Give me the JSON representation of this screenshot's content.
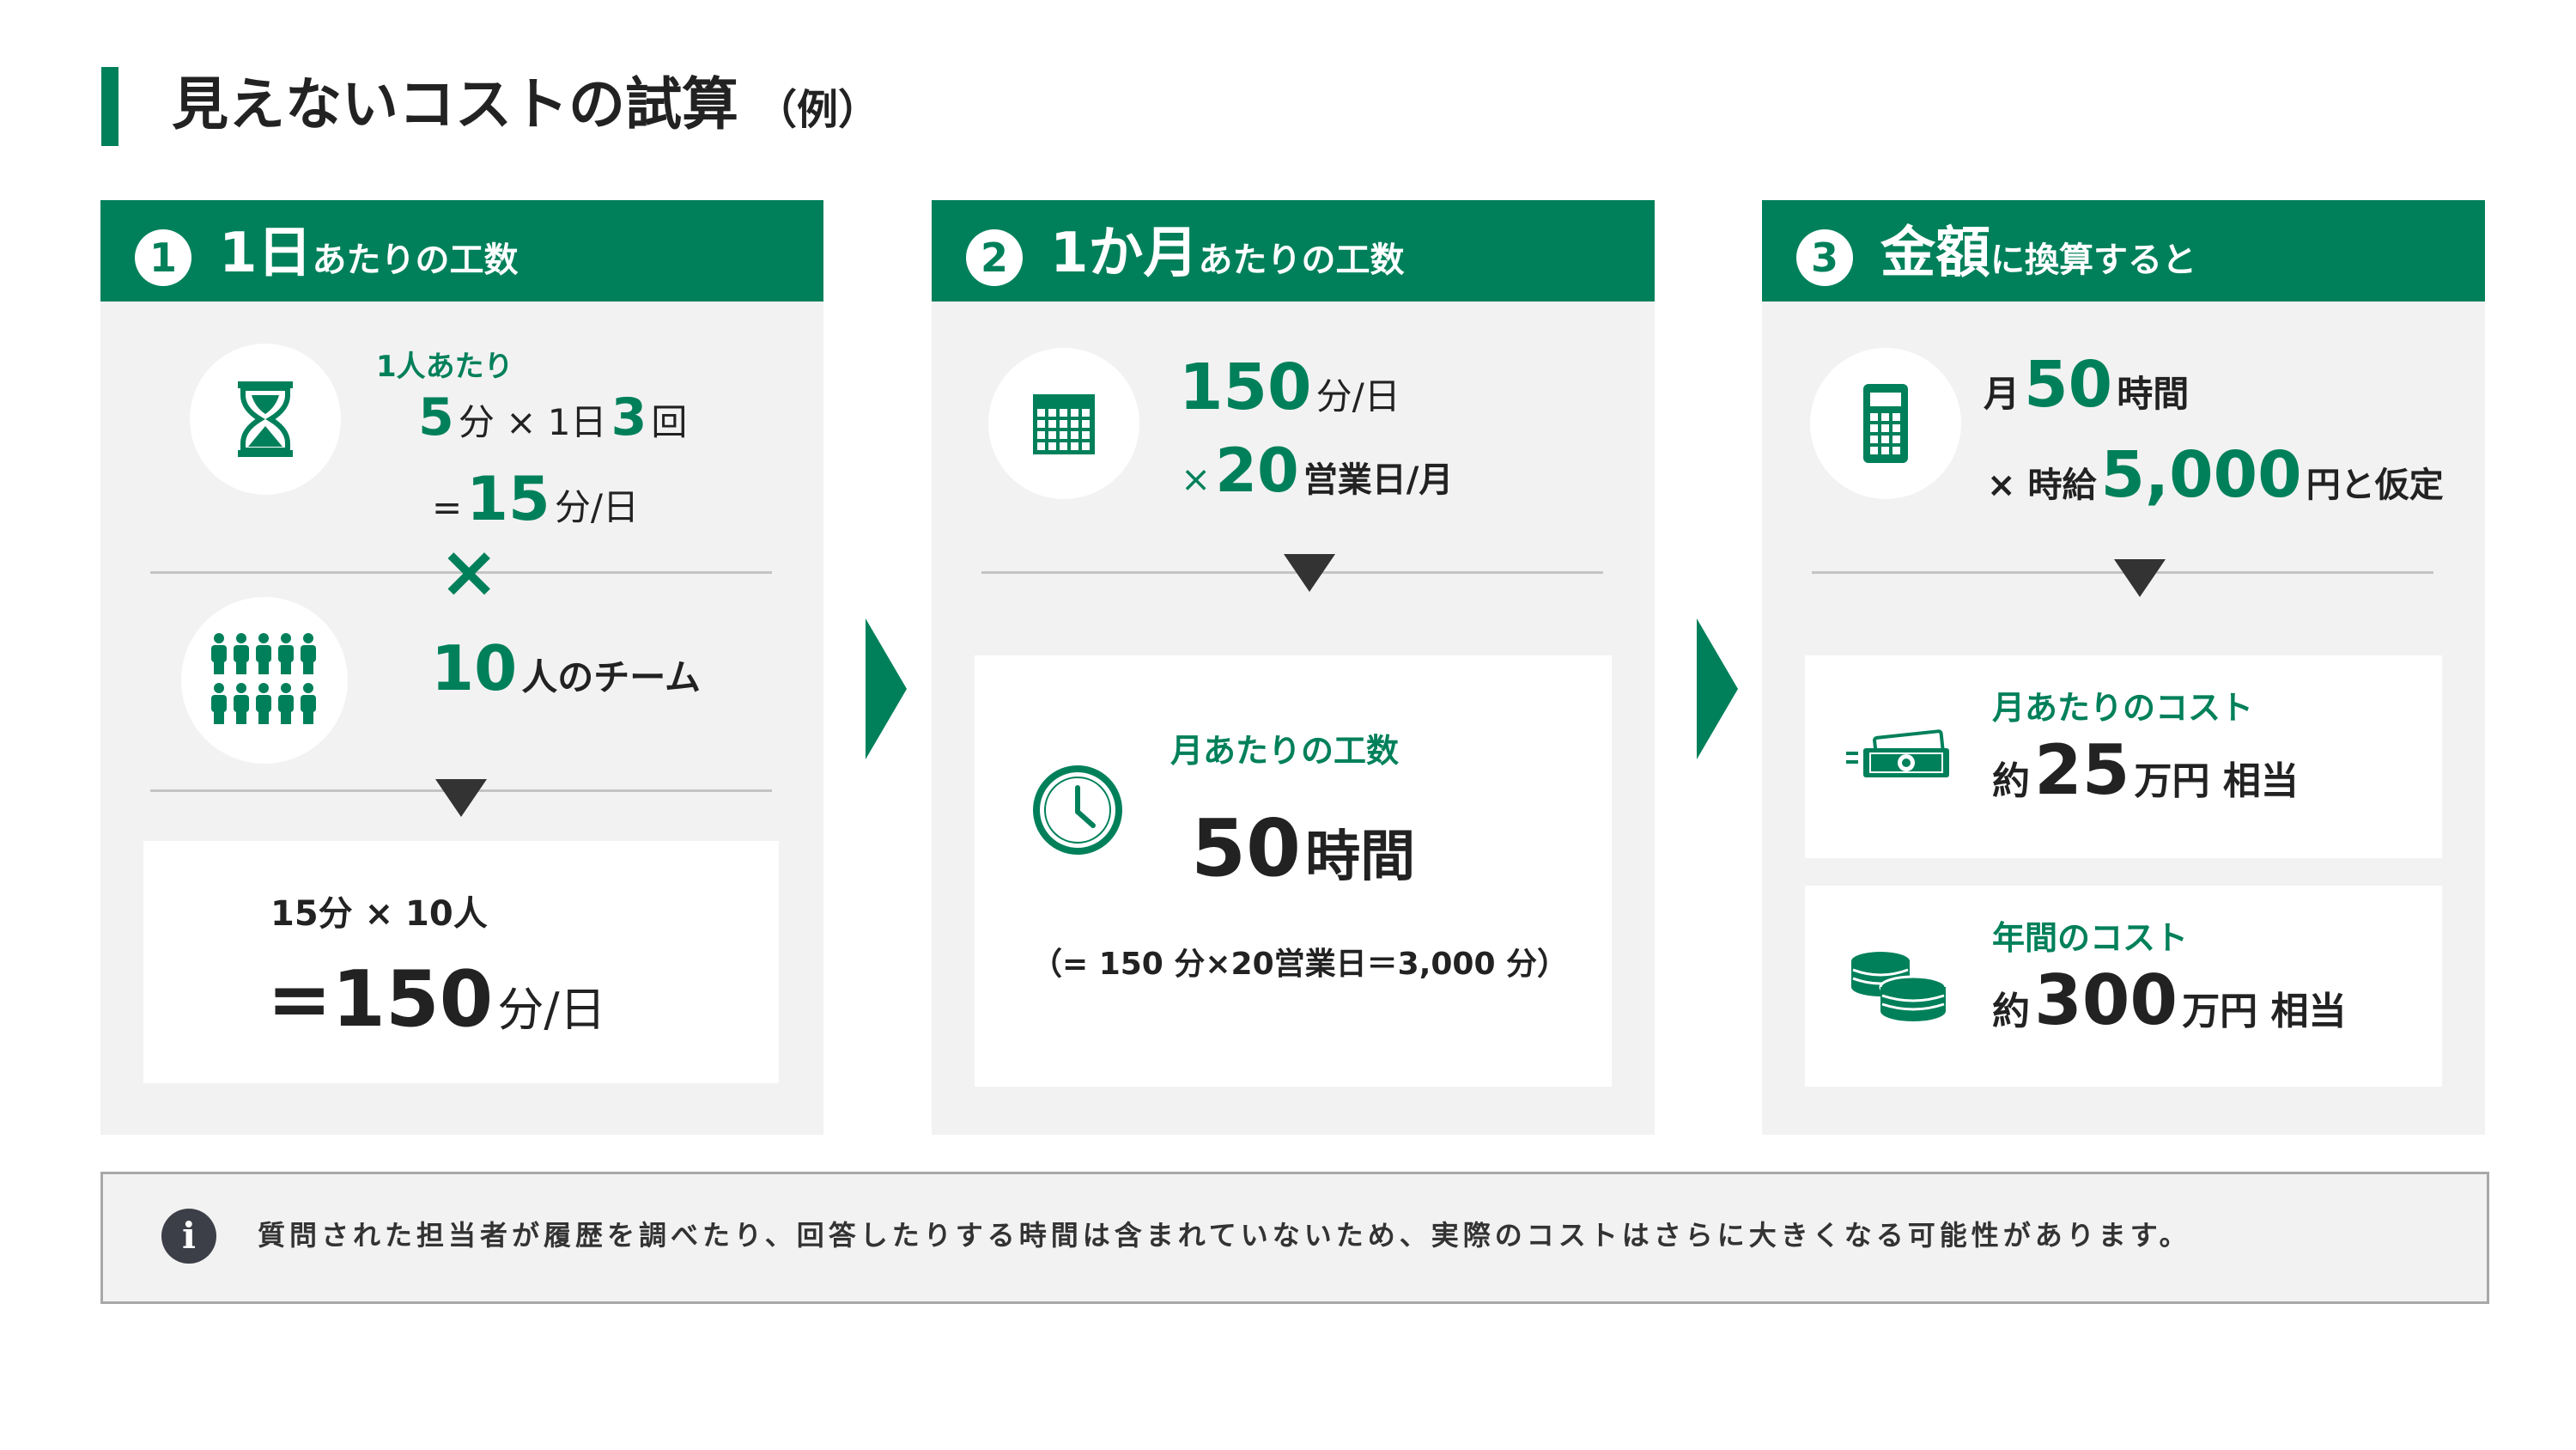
{
  "title": {
    "main": "見えないコストの試算",
    "sub": "（例）"
  },
  "panels": [
    {
      "num": "1",
      "head_big": "1日",
      "head_small": "あたりの工数",
      "per_person_label": "1人あたり",
      "calc1": {
        "v1": "5",
        "u1": "分 × 1日",
        "v2": "3",
        "u2": "回"
      },
      "calc2": {
        "eq": "=",
        "v": "15",
        "u": "分/日"
      },
      "times": "×",
      "team": {
        "v": "10",
        "u": "人のチーム"
      },
      "result": {
        "line1": "15分 × 10人",
        "line2_v": "=150",
        "line2_u": "分/日"
      }
    },
    {
      "num": "2",
      "head_big": "1か月",
      "head_small": "あたりの工数",
      "line1": {
        "v": "150",
        "u": "分/日"
      },
      "line2": {
        "pre": "×",
        "v": "20",
        "u": "営業日/月"
      },
      "result": {
        "label": "月あたりの工数",
        "v": "50",
        "u": "時間",
        "note": "（= 150 分×20営業日＝3,000 分）"
      }
    },
    {
      "num": "3",
      "head_big": "金額",
      "head_small": "に換算すると",
      "line1": {
        "pre": "月",
        "v": "50",
        "u": "時間"
      },
      "line2": {
        "pre": "× 時給",
        "v": "5,000",
        "u": "円と仮定"
      },
      "monthly": {
        "label": "月あたりのコスト",
        "pre": "約",
        "v": "25",
        "u": "万円 相当"
      },
      "yearly": {
        "label": "年間のコスト",
        "pre": "約",
        "v": "300",
        "u": "万円 相当"
      }
    }
  ],
  "note": {
    "icon": "i",
    "text": "質問された担当者が履歴を調べたり、回答したりする時間は含まれていないため、実際のコストはさらに大きくなる可能性があります。"
  },
  "colors": {
    "accent": "#00805a",
    "panel_bg": "#f2f2f2",
    "note_icon": "#3d3f48"
  }
}
